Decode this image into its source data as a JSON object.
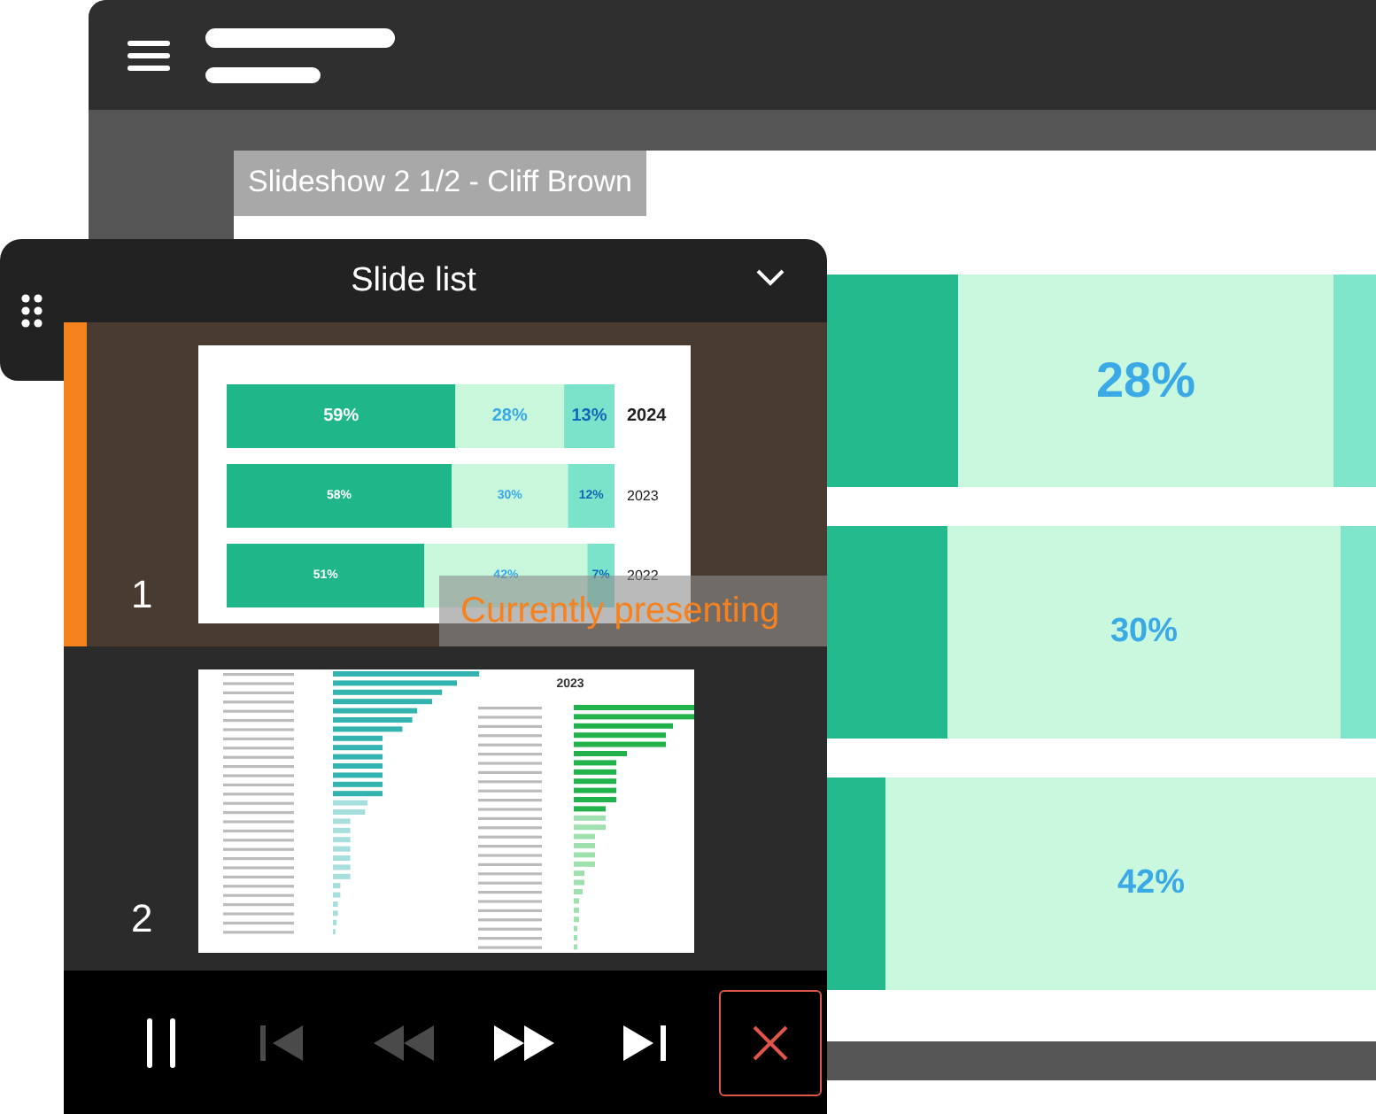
{
  "window": {
    "slide_label": "Slideshow 2 1/2 - Cliff Brown",
    "slide": {
      "rows": [
        {
          "label": "28%"
        },
        {
          "label": "30%"
        },
        {
          "label": "42%"
        }
      ]
    }
  },
  "slide_list": {
    "title": "Slide list",
    "expanded": true,
    "items": [
      {
        "number": "1",
        "selected": true,
        "badge": "Currently presenting",
        "thumbnail": {
          "chart_data": {
            "type": "bar",
            "orientation": "horizontal",
            "stacked": true,
            "data_labels": true,
            "categories": [
              "2024",
              "2023",
              "2022"
            ],
            "series": [
              {
                "color": "#1fb78a",
                "values": [
                  59,
                  58,
                  51
                ],
                "value_labels": [
                  "59%",
                  "58%",
                  "51%"
                ]
              },
              {
                "color": "#c8f7dc",
                "values": [
                  28,
                  30,
                  42
                ],
                "value_labels": [
                  "28%",
                  "30%",
                  "42%"
                ]
              },
              {
                "color": "#7be3c9",
                "values": [
                  13,
                  12,
                  7
                ],
                "value_labels": [
                  "13%",
                  "12%",
                  "7%"
                ]
              }
            ]
          }
        }
      },
      {
        "number": "2",
        "selected": false,
        "thumbnail": {
          "kind": "picture",
          "title": "2023"
        }
      }
    ]
  },
  "controls": [
    {
      "kind": "pause",
      "disabled": false
    },
    {
      "kind": "previous",
      "disabled": true
    },
    {
      "kind": "rewind",
      "disabled": true
    },
    {
      "kind": "fast-forward",
      "disabled": false
    },
    {
      "kind": "next",
      "disabled": false
    },
    {
      "kind": "close",
      "disabled": false
    }
  ]
}
